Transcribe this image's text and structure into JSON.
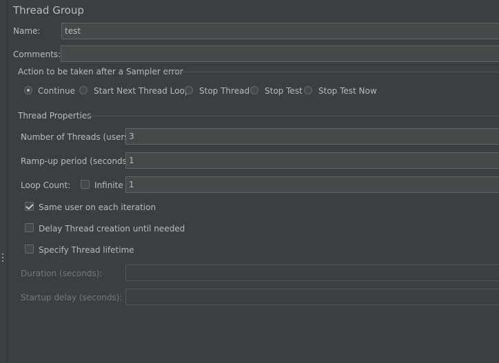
{
  "panel": {
    "title": "Thread Group"
  },
  "name": {
    "label": "Name:",
    "value": "test"
  },
  "comments": {
    "label": "Comments:",
    "value": ""
  },
  "sampler_error": {
    "heading": "Action to be taken after a Sampler error",
    "options": [
      "Continue",
      "Start Next Thread Loop",
      "Stop Thread",
      "Stop Test",
      "Stop Test Now"
    ],
    "selected": "Continue"
  },
  "thread_properties": {
    "heading": "Thread Properties",
    "threads_label": "Number of Threads (users):",
    "threads_value": "3",
    "rampup_label": "Ramp-up period (seconds):",
    "rampup_value": "1",
    "loop_label": "Loop Count:",
    "infinite_label": "Infinite",
    "infinite_checked": false,
    "loop_value": "1",
    "same_user_label": "Same user on each iteration",
    "same_user_checked": true,
    "delay_label": "Delay Thread creation until needed",
    "delay_checked": false,
    "lifetime_label": "Specify Thread lifetime",
    "lifetime_checked": false,
    "duration_label": "Duration (seconds):",
    "duration_value": "",
    "startup_label": "Startup delay (seconds):",
    "startup_value": ""
  },
  "colors": {
    "background": "#3c3f41",
    "field_bg": "#45494a",
    "text": "#bbbbbb",
    "disabled_text": "#777777"
  }
}
